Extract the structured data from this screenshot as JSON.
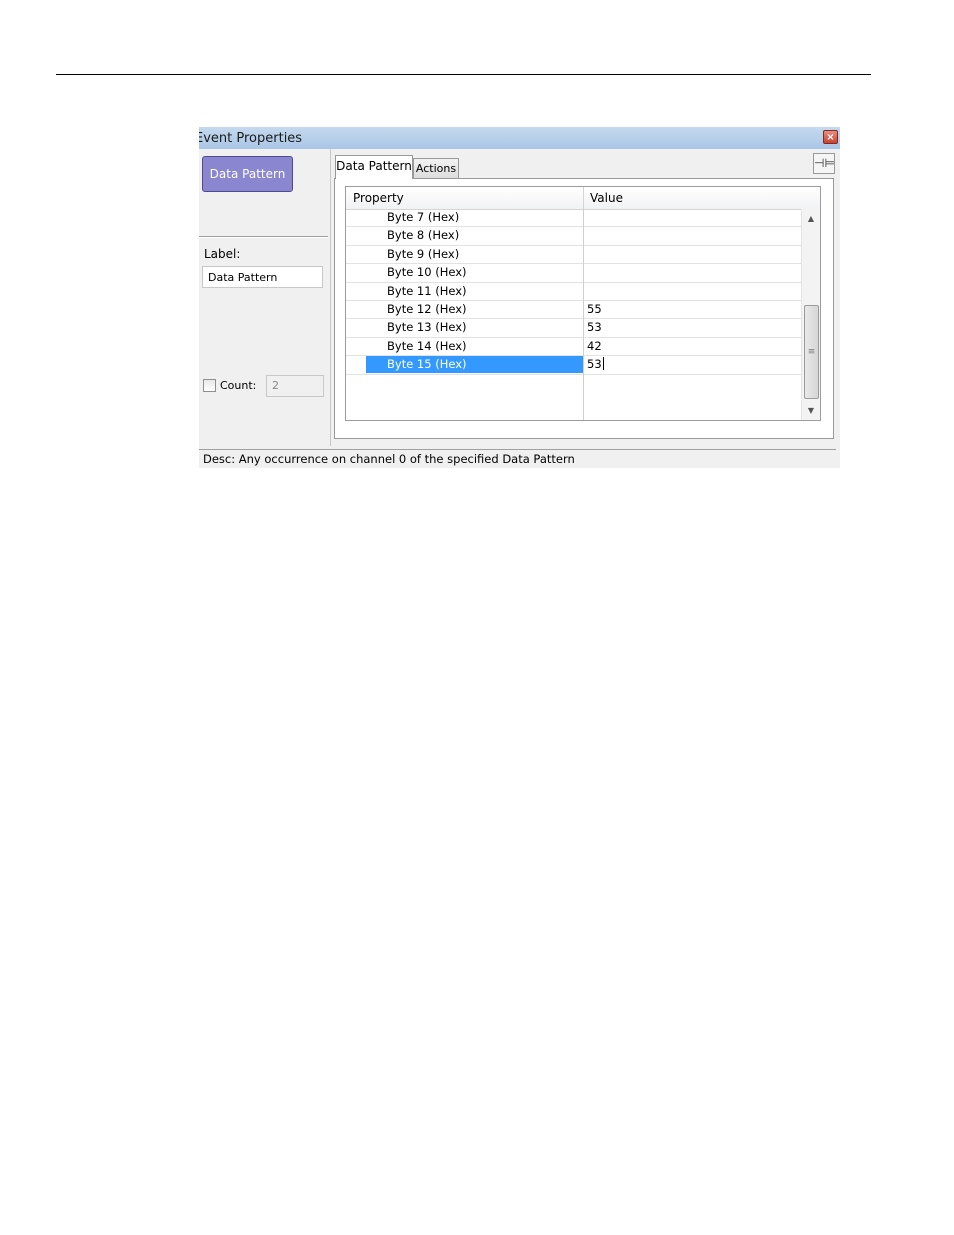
{
  "window": {
    "title": "Event Properties",
    "close_glyph": "×"
  },
  "left_panel": {
    "event_button_label": "Data Pattern",
    "label_caption": "Label:",
    "label_value": "Data Pattern",
    "count_caption": "Count:",
    "count_checked": false,
    "count_value": "2"
  },
  "tabs": [
    {
      "label": "Data Pattern",
      "active": true
    },
    {
      "label": "Actions",
      "active": false
    }
  ],
  "pin_icon": "pin-icon",
  "pin_glyph": "⊣⊨",
  "grid": {
    "columns": [
      "Property",
      "Value"
    ],
    "rows": [
      {
        "property": "Byte 7 (Hex)",
        "value": ""
      },
      {
        "property": "Byte 8 (Hex)",
        "value": ""
      },
      {
        "property": "Byte 9 (Hex)",
        "value": ""
      },
      {
        "property": "Byte 10 (Hex)",
        "value": ""
      },
      {
        "property": "Byte 11 (Hex)",
        "value": ""
      },
      {
        "property": "Byte 12 (Hex)",
        "value": "55"
      },
      {
        "property": "Byte 13 (Hex)",
        "value": "53"
      },
      {
        "property": "Byte 14 (Hex)",
        "value": "42"
      },
      {
        "property": "Byte 15 (Hex)",
        "value": "53",
        "selected": true
      }
    ],
    "scroll_up_glyph": "▲",
    "scroll_down_glyph": "▼",
    "scroll_grip_glyph": "≡"
  },
  "colors": {
    "event_button": "#8a86cf",
    "selection": "#3399ff",
    "title_bar": "#a9c6e6",
    "close_button": "#c8422f"
  },
  "status": {
    "description": "Desc: Any occurrence on channel 0 of the specified Data Pattern"
  }
}
